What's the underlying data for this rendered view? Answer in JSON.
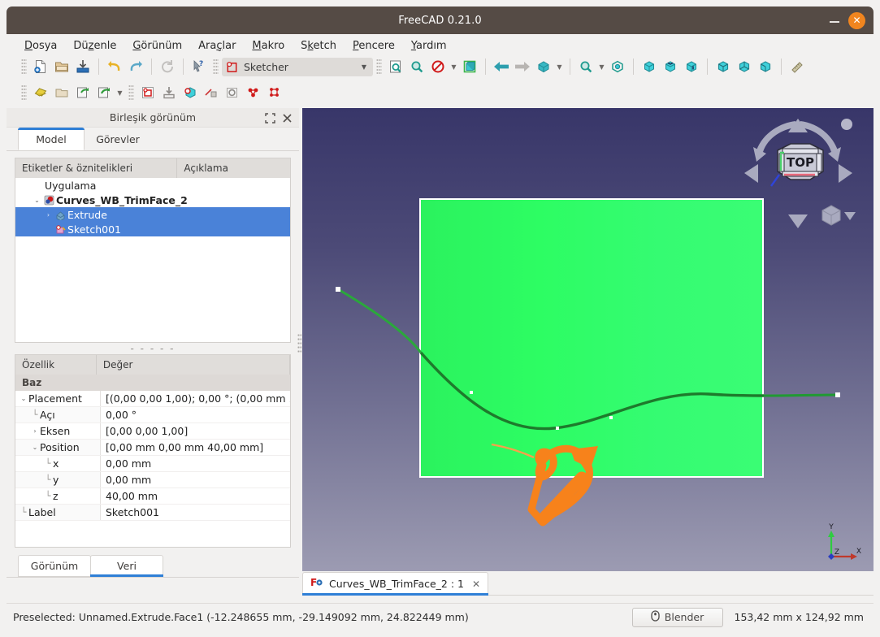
{
  "window": {
    "title": "FreeCAD 0.21.0",
    "minimize_label": "–",
    "close_label": "✕"
  },
  "menubar": {
    "items": [
      {
        "pre": "",
        "mn": "D",
        "post": "osya"
      },
      {
        "pre": "Dü",
        "mn": "z",
        "post": "enle"
      },
      {
        "pre": "",
        "mn": "G",
        "post": "örünüm"
      },
      {
        "pre": "Ara",
        "mn": "ç",
        "post": "lar"
      },
      {
        "pre": "",
        "mn": "M",
        "post": "akro"
      },
      {
        "pre": "S",
        "mn": "k",
        "post": "etch"
      },
      {
        "pre": "",
        "mn": "P",
        "post": "encere"
      },
      {
        "pre": "",
        "mn": "Y",
        "post": "ardım"
      }
    ]
  },
  "toolbars": {
    "workbench_selector": {
      "value": "Sketcher",
      "caret": "▼"
    },
    "row1_icons": [
      "new-document-icon",
      "open-folder-icon",
      "save-icon",
      "undo-icon",
      "redo-icon",
      "refresh-icon",
      "whats-this-icon"
    ],
    "row1_view_icons": [
      "fit-all-icon",
      "fit-selection-icon",
      "draw-style-icon",
      "axonometric-view-icon",
      "back-arrow-icon",
      "forward-arrow-icon",
      "isometric-view-icon",
      "zoom-icon",
      "stereo-icon"
    ],
    "row1_std_views": [
      "front-view-icon",
      "top-view-icon",
      "right-view-icon",
      "rear-view-icon",
      "bottom-view-icon",
      "left-view-icon",
      "measure-icon"
    ],
    "row2_icons": [
      "create-sketch-icon",
      "edit-sketch-icon",
      "leave-sketch-icon",
      "view-sketch-icon",
      "map-sketch-icon",
      "validate-sketch-icon",
      "merge-sketch-icon",
      "mirror-sketch-icon",
      "reorient-sketch-icon",
      "stop-operation-icon",
      "constraints-icon",
      "sketcher-virtual-space-icon"
    ]
  },
  "left_panel": {
    "header_title": "Birleşik görünüm",
    "header_float_icon": "restore-icon",
    "header_close_icon": "close-icon",
    "tabs": [
      {
        "label": "Model",
        "active": true
      },
      {
        "label": "Görevler",
        "active": false
      }
    ],
    "tree": {
      "columns": [
        "Etiketler & öznitelikleri",
        "Açıklama"
      ],
      "rows": [
        {
          "label": "Uygulama",
          "indent": 0,
          "twisty": "",
          "icon": "",
          "bold": false,
          "selected": false
        },
        {
          "label": "Curves_WB_TrimFace_2",
          "indent": 1,
          "twisty": "⌄",
          "icon": "document-icon",
          "bold": true,
          "selected": false
        },
        {
          "label": "Extrude",
          "indent": 2,
          "twisty": "›",
          "icon": "extrude-icon",
          "bold": false,
          "selected": true
        },
        {
          "label": "Sketch001",
          "indent": 2,
          "twisty": "",
          "icon": "sketch-icon",
          "bold": false,
          "selected": true
        }
      ]
    },
    "splitter_label": "- - - - -",
    "properties": {
      "columns": [
        "Özellik",
        "Değer"
      ],
      "group": "Baz",
      "rows": [
        {
          "name": "Placement",
          "value": "[(0,00 0,00 1,00); 0,00 °; (0,00 mm  …",
          "indent": 0,
          "expander": "⌄"
        },
        {
          "name": "Açı",
          "value": "0,00 °",
          "indent": 1,
          "expander": ""
        },
        {
          "name": "Eksen",
          "value": "[0,00 0,00 1,00]",
          "indent": 1,
          "expander": "›"
        },
        {
          "name": "Position",
          "value": "[0,00 mm  0,00 mm  40,00 mm]",
          "indent": 1,
          "expander": "⌄"
        },
        {
          "name": "x",
          "value": "0,00 mm",
          "indent": 2,
          "expander": ""
        },
        {
          "name": "y",
          "value": "0,00 mm",
          "indent": 2,
          "expander": ""
        },
        {
          "name": "z",
          "value": "40,00 mm",
          "indent": 2,
          "expander": ""
        },
        {
          "name": "Label",
          "value": "Sketch001",
          "indent": 0,
          "expander": ""
        }
      ]
    },
    "bottom_tabs": [
      {
        "label": "Görünüm",
        "active": false
      },
      {
        "label": "Veri",
        "active": true
      }
    ]
  },
  "viewport": {
    "nav_cube_face": "TOP",
    "nav_cube_name": "navigation-cube",
    "axis_labels": {
      "x": "X",
      "y": "Y",
      "z": "Z"
    },
    "colors": {
      "face_green": "#2dfd63",
      "curve_dark_green": "#1e8a2e",
      "curve_light_green": "#2aa83b",
      "annotation_orange": "#f7821b",
      "background_top": "#383669",
      "background_bottom": "#9c9bb2",
      "axis_x": "#c0392b",
      "axis_y": "#2ecc40",
      "axis_z": "#2a3fc0"
    }
  },
  "mdi": {
    "tab_label": "Curves_WB_TrimFace_2 : 1",
    "tab_icon": "freecad-document-icon",
    "close_label": "✕"
  },
  "statusbar": {
    "message": "Preselected: Unnamed.Extrude.Face1 (-12.248655 mm, -29.149092 mm, 24.822449 mm)",
    "blender_button": "Blender",
    "blender_icon": "mouse-icon",
    "dimensions": "153,42 mm x 124,92 mm"
  }
}
